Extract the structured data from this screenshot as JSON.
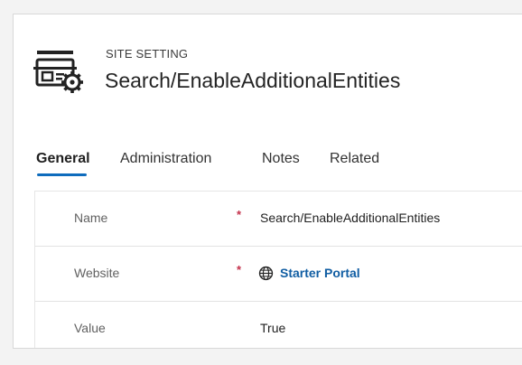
{
  "header": {
    "entity_type": "SITE SETTING",
    "title": "Search/EnableAdditionalEntities",
    "icon": "site-setting-icon"
  },
  "tabs": [
    {
      "label": "General",
      "active": true
    },
    {
      "label": "Administration",
      "active": false
    },
    {
      "label": "Notes",
      "active": false
    },
    {
      "label": "Related",
      "active": false
    }
  ],
  "fields": {
    "name": {
      "label": "Name",
      "required": "*",
      "value": "Search/EnableAdditionalEntities"
    },
    "website": {
      "label": "Website",
      "required": "*",
      "value": "Starter Portal",
      "icon": "globe-icon"
    },
    "value": {
      "label": "Value",
      "value": "True"
    }
  },
  "colors": {
    "accent": "#0f6cbd",
    "link": "#115ea3",
    "required": "#c4314b"
  }
}
